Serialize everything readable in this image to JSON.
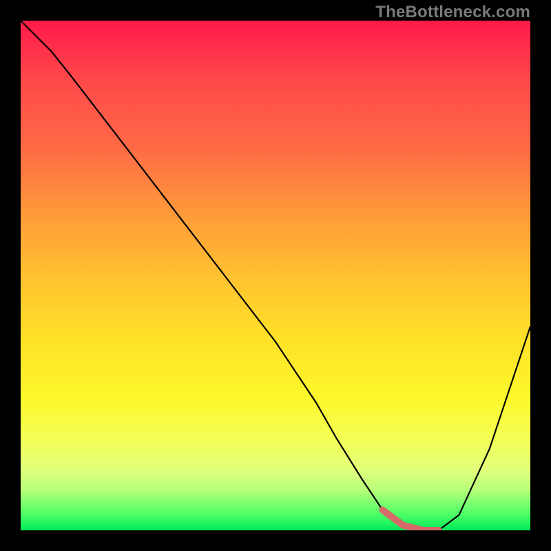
{
  "watermark": "TheBottleneck.com",
  "chart_data": {
    "type": "line",
    "title": "",
    "xlabel": "",
    "ylabel": "",
    "xlim": [
      0,
      100
    ],
    "ylim": [
      0,
      100
    ],
    "grid": false,
    "legend": false,
    "series": [
      {
        "name": "curve",
        "x": [
          0,
          6,
          10,
          20,
          30,
          40,
          50,
          58,
          62,
          67,
          71,
          75,
          79,
          82,
          86,
          92,
          100
        ],
        "values": [
          100,
          94,
          89,
          76,
          63,
          50,
          37,
          25,
          18,
          10,
          4,
          1,
          0,
          0,
          3,
          16,
          40
        ]
      },
      {
        "name": "highlight-flat",
        "x": [
          71,
          75,
          79,
          82
        ],
        "values": [
          4,
          1,
          0,
          0
        ]
      }
    ],
    "colors": {
      "curve": "#000000",
      "highlight": "#d46a6a",
      "gradient_top": "#ff1a4a",
      "gradient_bottom": "#00e85a"
    }
  }
}
